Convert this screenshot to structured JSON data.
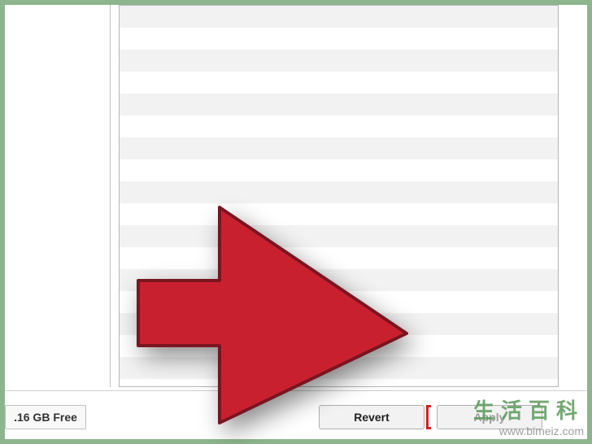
{
  "storage": {
    "free_label": ".16 GB Free"
  },
  "buttons": {
    "revert": "Revert",
    "apply": "Apply"
  },
  "watermark": {
    "title": "生活百科",
    "url": "www.bimeiz.com"
  }
}
